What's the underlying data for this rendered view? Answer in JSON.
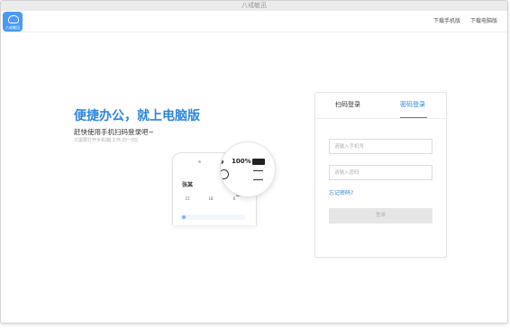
{
  "window": {
    "title": "八戒敏迅"
  },
  "header": {
    "logo_text": "八戒敏迅",
    "download_phone": "下载手机版",
    "download_pc": "下载电脑版"
  },
  "promo": {
    "headline": "便捷办公，就上电脑版",
    "subline": "赶快使用手机扫码登录吧~",
    "tiny": "只需要打开手机端[工作-扫一扫]",
    "magnifier_battery": "100%",
    "phone": {
      "name": "张某",
      "stats": [
        "15",
        "18",
        "6"
      ]
    }
  },
  "login": {
    "tabs": [
      {
        "label": "扫码登录",
        "active": false
      },
      {
        "label": "密码登录",
        "active": true
      }
    ],
    "phone_placeholder": "请输入手机号",
    "password_placeholder": "请输入密码",
    "forgot": "忘记密码?",
    "submit": "登录"
  },
  "colors": {
    "accent": "#2e86de",
    "logo_bg": "#4a9af5",
    "button_disabled": "#e6e6e6"
  }
}
